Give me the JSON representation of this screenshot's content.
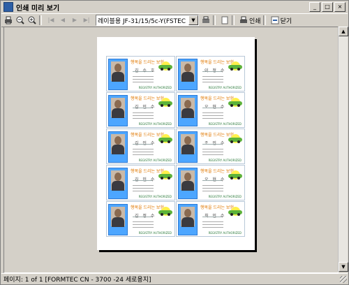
{
  "window": {
    "title": "인쇄 미리 보기",
    "min_label": "_",
    "max_label": "□",
    "close_label": "×"
  },
  "toolbar": {
    "printer_value": "레이블용 JF-31/15/5c-Y(FSTEC",
    "print_label": "인쇄",
    "close_label": "닫기"
  },
  "card": {
    "slogan": "행복을 드리는 보험",
    "names": [
      "김 수 호",
      "이 정 수",
      "김 민 수",
      "오 현 수",
      "김 인 수",
      "조 민 수",
      "김 민 수",
      "오 현 수",
      "김 정 수",
      "최 민 수"
    ],
    "footer_tag": "REGISTRY AUTHORIZED"
  },
  "statusbar": {
    "text": "페이지: 1 of 1 [FORMTEC CN - 3700 -24 세로용지]"
  },
  "icons": [
    "app-icon",
    "print-icon",
    "zoom-out-icon",
    "zoom-in-icon",
    "first-page-icon",
    "prev-page-icon",
    "next-page-icon",
    "last-page-icon",
    "printer-setup-icon",
    "page-setup-icon"
  ],
  "colors": {
    "photo_frame": "#4da6ff",
    "slogan": "#e07800",
    "car": "#5db33a"
  }
}
